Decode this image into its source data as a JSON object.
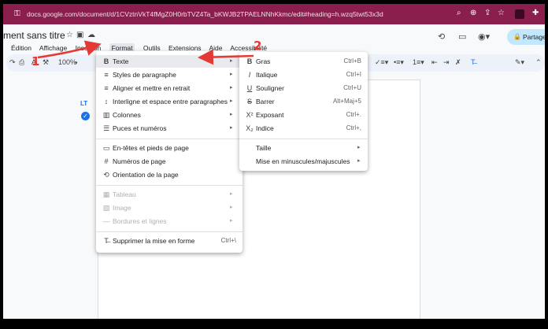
{
  "browser": {
    "url": "docs.google.com/document/d/1CVztnVkT4fMgZ0H0rbTVZ4Ta_bKWJB2TPAELNNhKkmc/edit#heading=h.wzq5twt53x3d"
  },
  "doc": {
    "title": "ment sans titre",
    "menus": [
      "Édition",
      "Affichage",
      "Insertion",
      "Format",
      "Outils",
      "Extensions",
      "Aide",
      "Accessibilité"
    ],
    "share_label": "Partage",
    "zoom": "100%"
  },
  "format_menu": {
    "items": [
      {
        "icon": "B",
        "label": "Texte",
        "submenu": true
      },
      {
        "icon": "≡",
        "label": "Styles de paragraphe",
        "submenu": true
      },
      {
        "icon": "≡",
        "label": "Aligner et mettre en retrait",
        "submenu": true
      },
      {
        "icon": "↕",
        "label": "Interligne et espace entre paragraphes",
        "submenu": true
      },
      {
        "icon": "▥",
        "label": "Colonnes",
        "submenu": true
      },
      {
        "icon": "☰",
        "label": "Puces et numéros",
        "submenu": true
      },
      {
        "icon": "▭",
        "label": "En-têtes et pieds de page",
        "submenu": false
      },
      {
        "icon": "#",
        "label": "Numéros de page",
        "submenu": false
      },
      {
        "icon": "⟲",
        "label": "Orientation de la page",
        "submenu": false
      },
      {
        "icon": "▦",
        "label": "Tableau",
        "submenu": true,
        "disabled": true
      },
      {
        "icon": "▨",
        "label": "Image",
        "submenu": true,
        "disabled": true
      },
      {
        "icon": "—",
        "label": "Bordures et lignes",
        "submenu": true,
        "disabled": true
      },
      {
        "icon": "T̶",
        "label": "Supprimer la mise en forme",
        "shortcut": "Ctrl+\\"
      }
    ]
  },
  "text_submenu": {
    "items": [
      {
        "icon": "B",
        "label": "Gras",
        "shortcut": "Ctrl+B"
      },
      {
        "icon": "I",
        "label": "Italique",
        "shortcut": "Ctrl+I"
      },
      {
        "icon": "U",
        "label": "Souligner",
        "shortcut": "Ctrl+U"
      },
      {
        "icon": "S",
        "label": "Barrer",
        "shortcut": "Alt+Maj+5"
      },
      {
        "icon": "X²",
        "label": "Exposant",
        "shortcut": "Ctrl+."
      },
      {
        "icon": "X₂",
        "label": "Indice",
        "shortcut": "Ctrl+,"
      },
      {
        "label": "Taille",
        "submenu": true
      },
      {
        "label": "Mise en minuscules/majuscules",
        "submenu": true
      }
    ]
  },
  "annotations": {
    "step1": "1",
    "step2": "2",
    "color": "#e53935"
  },
  "colors": {
    "address_bar": "#8a1f4d",
    "share_button": "#c2e7ff",
    "accent": "#1a73e8"
  }
}
